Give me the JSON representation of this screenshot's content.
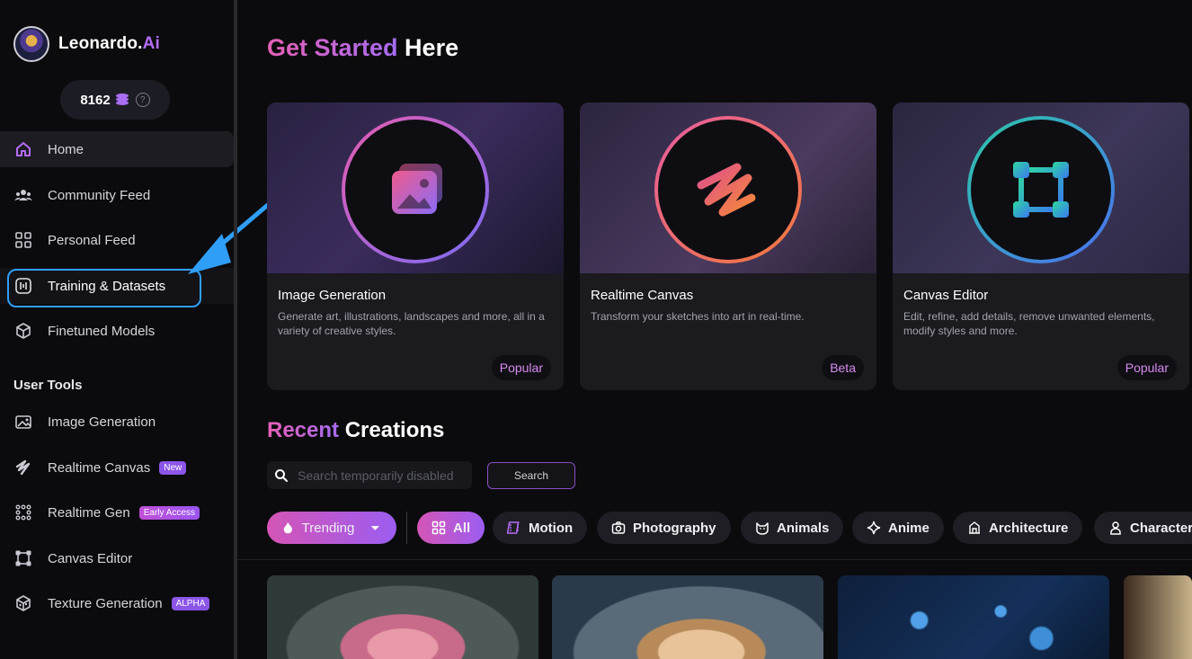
{
  "brand": {
    "name": "Leonardo.",
    "suffix": "Ai"
  },
  "tokens": {
    "count": "8162",
    "help": "?"
  },
  "nav": {
    "home": "Home",
    "community_feed": "Community Feed",
    "personal_feed": "Personal Feed",
    "training": "Training & Datasets",
    "finetuned": "Finetuned Models"
  },
  "user_tools": {
    "heading": "User Tools",
    "image_generation": "Image Generation",
    "realtime_canvas": "Realtime Canvas",
    "realtime_canvas_badge": "New",
    "realtime_gen": "Realtime Gen",
    "realtime_gen_badge": "Early Access",
    "canvas_editor": "Canvas Editor",
    "texture_generation": "Texture Generation",
    "texture_generation_badge": "ALPHA"
  },
  "get_started": {
    "accent": "Get Started",
    "rest": " Here"
  },
  "cards": [
    {
      "title": "Image Generation",
      "desc": "Generate art, illustrations, landscapes and more, all in a variety of creative styles.",
      "tag": "Popular"
    },
    {
      "title": "Realtime Canvas",
      "desc": "Transform your sketches into art in real-time.",
      "tag": "Beta"
    },
    {
      "title": "Canvas Editor",
      "desc": "Edit, refine, add details, remove unwanted elements, modify styles and more.",
      "tag": "Popular"
    }
  ],
  "recent": {
    "accent": "Recent",
    "rest": " Creations"
  },
  "search": {
    "placeholder": "Search temporarily disabled",
    "button": "Search"
  },
  "filters": {
    "trending": "Trending",
    "all": "All",
    "motion": "Motion",
    "photography": "Photography",
    "animals": "Animals",
    "anime": "Anime",
    "architecture": "Architecture",
    "character": "Character"
  },
  "colors": {
    "accent_pink": "#e660b6",
    "accent_purple": "#a56bf3",
    "highlight_blue": "#2f9ef7"
  }
}
